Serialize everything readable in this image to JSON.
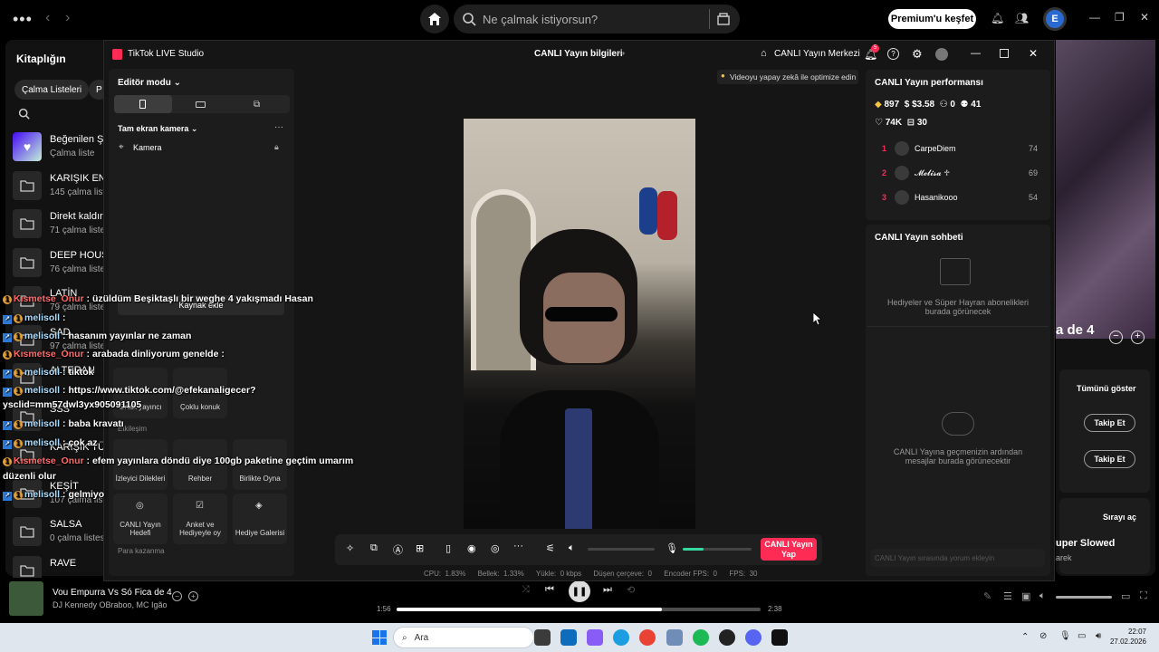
{
  "spotify": {
    "search_placeholder": "Ne çalmak istiyorsun?",
    "premium_label": "Premium'u keşfet",
    "avatar_letter": "E",
    "library_title": "Kitaplığın",
    "chips": [
      "Çalma Listeleri",
      "P"
    ],
    "library": [
      {
        "name": "Beğenilen Ş",
        "sub": "Çalma liste",
        "type": "liked"
      },
      {
        "name": "KARIŞIK ENI",
        "sub": "145 çalma liste",
        "type": "folder"
      },
      {
        "name": "Direkt kaldır",
        "sub": "71 çalma listes",
        "type": "folder"
      },
      {
        "name": "DEEP HOUS",
        "sub": "76 çalma listes",
        "type": "folder"
      },
      {
        "name": "LATİN",
        "sub": "79 çalma liste",
        "type": "folder"
      },
      {
        "name": "SAD",
        "sub": "97 çalma liste",
        "type": "folder"
      },
      {
        "name": "ALTERAN",
        "sub": "",
        "type": "folder"
      },
      {
        "name": "SSS",
        "sub": "",
        "type": "folder"
      },
      {
        "name": "KARIŞIK TÜI",
        "sub": "",
        "type": "folder"
      },
      {
        "name": "KEŞİT",
        "sub": "107 çalma liste",
        "type": "folder"
      },
      {
        "name": "SALSA",
        "sub": "0 çalma listesi",
        "type": "folder"
      },
      {
        "name": "RAVE",
        "sub": "",
        "type": "folder"
      }
    ],
    "right": {
      "title_fragment": "a de 4",
      "show_all": "Tümünü göster",
      "follow": "Takip Et",
      "queue": "Sırayı aç",
      "next_title": "uper Slowed",
      "next_sub": "arek"
    },
    "player": {
      "title": "Vou Empurra Vs Só Fica de 4",
      "artist": "DJ Kennedy OBraboo, MC Igão",
      "elapsed": "1:56",
      "duration": "2:38",
      "progress": 0.73
    }
  },
  "tiktok": {
    "app_title": "TikTok LIVE Studio",
    "center_title": "CANLI Yayın bilgileri",
    "hub_label": "CANLI Yayın Merkezi",
    "notif_count": "5",
    "editor_mode": "Editör modu",
    "camera_section": "Tam ekran kamera",
    "camera_item": "Kamera",
    "add_source": "Kaynak ekle",
    "tiles_multi": [
      {
        "label": "Ortak yayıncı"
      },
      {
        "label": "Çoklu konuk"
      }
    ],
    "section_interaction": "Etkileşim",
    "tiles_interaction": [
      {
        "label": "İzleyici Dilekleri"
      },
      {
        "label": "Rehber"
      },
      {
        "label": "Birlikte Oyna"
      }
    ],
    "tiles_goals": [
      {
        "label": "CANLI Yayın Hedefi"
      },
      {
        "label": "Anket ve Hediyeyle oy"
      },
      {
        "label": "Hediye Galerisi"
      }
    ],
    "section_earn": "Para kazanma",
    "optimize_hint": "Videoyu yapay zekâ ile optimize edin",
    "go_live": "CANLI Yayın Yap",
    "volume_level": 0.3,
    "stats": "CPU:  1.83%      Bellek:  1.33%      Yükle:  0 kbps      Düşen çerçeve:  0      Encoder FPS:  0      FPS:  30",
    "performance": {
      "title": "CANLI Yayın performansı",
      "gifts": "897",
      "revenue": "$3.58",
      "new_followers": "0",
      "viewers": "41",
      "likes": "74K",
      "shares": "30"
    },
    "ranking": [
      {
        "rank": "1",
        "name": "CarpeDiem",
        "score": "74"
      },
      {
        "rank": "2",
        "name": "𝓜𝓮𝓵𝓲𝓼𝓪 ♱",
        "score": "69"
      },
      {
        "rank": "3",
        "name": "Hasanikooo",
        "score": "54"
      }
    ],
    "chat_title": "CANLI Yayın sohbeti",
    "gifts_placeholder": "Hediyeler ve Süper Hayran abonelikleri burada görünecek",
    "chat_placeholder": "CANLI Yayına geçmenizin ardından mesajlar burada görünecektir",
    "chat_input": "CANLI Yayın sırasında yorum ekleyin"
  },
  "overlay_chat": [
    {
      "user": "Kısmetse_Onur",
      "text": ": üzüldüm Beşiktaşlı bir weghe 4 yakışmadı Hasan"
    },
    {
      "user": "melisoll",
      "text": ":"
    },
    {
      "user": "melisoll",
      "text": ": hasanım yayınlar ne zaman"
    },
    {
      "user": "Kısmetse_Onur",
      "text": ": arabada dinliyorum genelde :"
    },
    {
      "user": "melisoll",
      "text": ": tiktok"
    },
    {
      "user": "melisoll",
      "text": ": https://www.tiktok.com/@efekanaligecer?"
    },
    {
      "user": "",
      "text": "ysclid=mm57dwl3yx905091105"
    },
    {
      "user": "melisoll",
      "text": ": baba kravatı"
    },
    {
      "user": "melisoll",
      "text": ": çok az"
    },
    {
      "user": "Kısmetse_Onur",
      "text": ": efem yayınlara döndü diye 100gb paketine geçtim umarım"
    },
    {
      "user": "",
      "text": "düzenli olur"
    },
    {
      "user": "melisoll",
      "text": ": gelmiyo"
    }
  ],
  "taskbar": {
    "search": "Ara",
    "time": "22:07",
    "date": "27.02.2026"
  }
}
